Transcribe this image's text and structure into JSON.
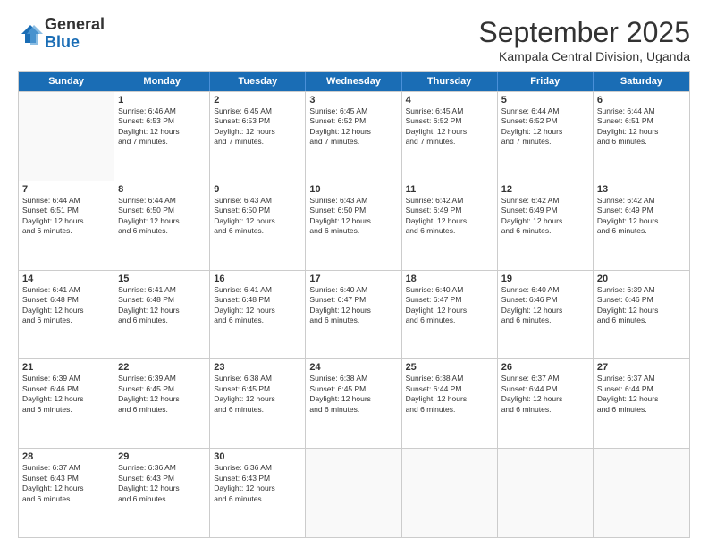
{
  "logo": {
    "general": "General",
    "blue": "Blue"
  },
  "title": "September 2025",
  "subtitle": "Kampala Central Division, Uganda",
  "days": [
    "Sunday",
    "Monday",
    "Tuesday",
    "Wednesday",
    "Thursday",
    "Friday",
    "Saturday"
  ],
  "rows": [
    [
      {
        "day": "",
        "lines": []
      },
      {
        "day": "1",
        "lines": [
          "Sunrise: 6:46 AM",
          "Sunset: 6:53 PM",
          "Daylight: 12 hours",
          "and 7 minutes."
        ]
      },
      {
        "day": "2",
        "lines": [
          "Sunrise: 6:45 AM",
          "Sunset: 6:53 PM",
          "Daylight: 12 hours",
          "and 7 minutes."
        ]
      },
      {
        "day": "3",
        "lines": [
          "Sunrise: 6:45 AM",
          "Sunset: 6:52 PM",
          "Daylight: 12 hours",
          "and 7 minutes."
        ]
      },
      {
        "day": "4",
        "lines": [
          "Sunrise: 6:45 AM",
          "Sunset: 6:52 PM",
          "Daylight: 12 hours",
          "and 7 minutes."
        ]
      },
      {
        "day": "5",
        "lines": [
          "Sunrise: 6:44 AM",
          "Sunset: 6:52 PM",
          "Daylight: 12 hours",
          "and 7 minutes."
        ]
      },
      {
        "day": "6",
        "lines": [
          "Sunrise: 6:44 AM",
          "Sunset: 6:51 PM",
          "Daylight: 12 hours",
          "and 6 minutes."
        ]
      }
    ],
    [
      {
        "day": "7",
        "lines": [
          "Sunrise: 6:44 AM",
          "Sunset: 6:51 PM",
          "Daylight: 12 hours",
          "and 6 minutes."
        ]
      },
      {
        "day": "8",
        "lines": [
          "Sunrise: 6:44 AM",
          "Sunset: 6:50 PM",
          "Daylight: 12 hours",
          "and 6 minutes."
        ]
      },
      {
        "day": "9",
        "lines": [
          "Sunrise: 6:43 AM",
          "Sunset: 6:50 PM",
          "Daylight: 12 hours",
          "and 6 minutes."
        ]
      },
      {
        "day": "10",
        "lines": [
          "Sunrise: 6:43 AM",
          "Sunset: 6:50 PM",
          "Daylight: 12 hours",
          "and 6 minutes."
        ]
      },
      {
        "day": "11",
        "lines": [
          "Sunrise: 6:42 AM",
          "Sunset: 6:49 PM",
          "Daylight: 12 hours",
          "and 6 minutes."
        ]
      },
      {
        "day": "12",
        "lines": [
          "Sunrise: 6:42 AM",
          "Sunset: 6:49 PM",
          "Daylight: 12 hours",
          "and 6 minutes."
        ]
      },
      {
        "day": "13",
        "lines": [
          "Sunrise: 6:42 AM",
          "Sunset: 6:49 PM",
          "Daylight: 12 hours",
          "and 6 minutes."
        ]
      }
    ],
    [
      {
        "day": "14",
        "lines": [
          "Sunrise: 6:41 AM",
          "Sunset: 6:48 PM",
          "Daylight: 12 hours",
          "and 6 minutes."
        ]
      },
      {
        "day": "15",
        "lines": [
          "Sunrise: 6:41 AM",
          "Sunset: 6:48 PM",
          "Daylight: 12 hours",
          "and 6 minutes."
        ]
      },
      {
        "day": "16",
        "lines": [
          "Sunrise: 6:41 AM",
          "Sunset: 6:48 PM",
          "Daylight: 12 hours",
          "and 6 minutes."
        ]
      },
      {
        "day": "17",
        "lines": [
          "Sunrise: 6:40 AM",
          "Sunset: 6:47 PM",
          "Daylight: 12 hours",
          "and 6 minutes."
        ]
      },
      {
        "day": "18",
        "lines": [
          "Sunrise: 6:40 AM",
          "Sunset: 6:47 PM",
          "Daylight: 12 hours",
          "and 6 minutes."
        ]
      },
      {
        "day": "19",
        "lines": [
          "Sunrise: 6:40 AM",
          "Sunset: 6:46 PM",
          "Daylight: 12 hours",
          "and 6 minutes."
        ]
      },
      {
        "day": "20",
        "lines": [
          "Sunrise: 6:39 AM",
          "Sunset: 6:46 PM",
          "Daylight: 12 hours",
          "and 6 minutes."
        ]
      }
    ],
    [
      {
        "day": "21",
        "lines": [
          "Sunrise: 6:39 AM",
          "Sunset: 6:46 PM",
          "Daylight: 12 hours",
          "and 6 minutes."
        ]
      },
      {
        "day": "22",
        "lines": [
          "Sunrise: 6:39 AM",
          "Sunset: 6:45 PM",
          "Daylight: 12 hours",
          "and 6 minutes."
        ]
      },
      {
        "day": "23",
        "lines": [
          "Sunrise: 6:38 AM",
          "Sunset: 6:45 PM",
          "Daylight: 12 hours",
          "and 6 minutes."
        ]
      },
      {
        "day": "24",
        "lines": [
          "Sunrise: 6:38 AM",
          "Sunset: 6:45 PM",
          "Daylight: 12 hours",
          "and 6 minutes."
        ]
      },
      {
        "day": "25",
        "lines": [
          "Sunrise: 6:38 AM",
          "Sunset: 6:44 PM",
          "Daylight: 12 hours",
          "and 6 minutes."
        ]
      },
      {
        "day": "26",
        "lines": [
          "Sunrise: 6:37 AM",
          "Sunset: 6:44 PM",
          "Daylight: 12 hours",
          "and 6 minutes."
        ]
      },
      {
        "day": "27",
        "lines": [
          "Sunrise: 6:37 AM",
          "Sunset: 6:44 PM",
          "Daylight: 12 hours",
          "and 6 minutes."
        ]
      }
    ],
    [
      {
        "day": "28",
        "lines": [
          "Sunrise: 6:37 AM",
          "Sunset: 6:43 PM",
          "Daylight: 12 hours",
          "and 6 minutes."
        ]
      },
      {
        "day": "29",
        "lines": [
          "Sunrise: 6:36 AM",
          "Sunset: 6:43 PM",
          "Daylight: 12 hours",
          "and 6 minutes."
        ]
      },
      {
        "day": "30",
        "lines": [
          "Sunrise: 6:36 AM",
          "Sunset: 6:43 PM",
          "Daylight: 12 hours",
          "and 6 minutes."
        ]
      },
      {
        "day": "",
        "lines": []
      },
      {
        "day": "",
        "lines": []
      },
      {
        "day": "",
        "lines": []
      },
      {
        "day": "",
        "lines": []
      }
    ]
  ]
}
